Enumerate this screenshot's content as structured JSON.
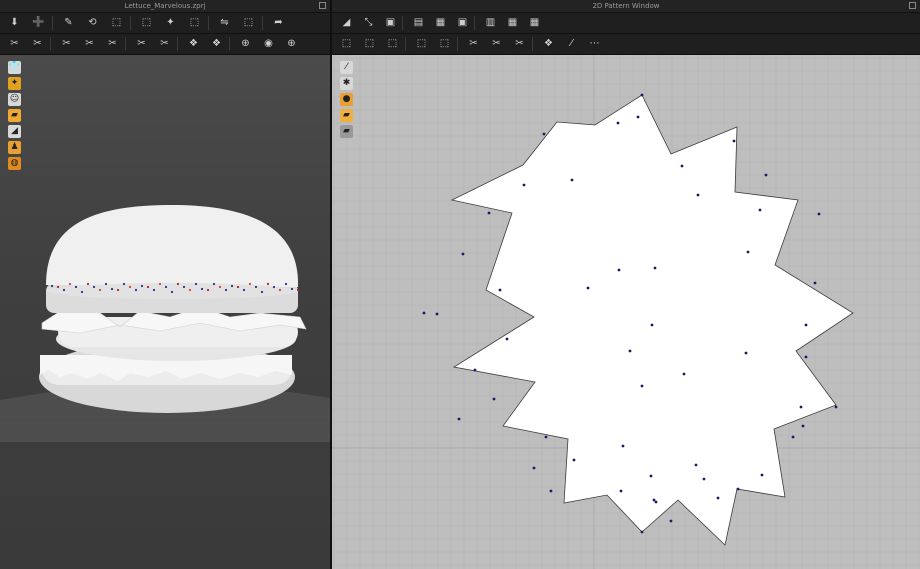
{
  "left_panel": {
    "title": "Lettuce_Marvelous.zprj"
  },
  "right_panel": {
    "title": "2D Pattern Window"
  },
  "toolbar_left_row1": [
    "⬇",
    "➕",
    "✎",
    "⟲",
    "⬚",
    "⬚",
    "✦",
    "⬚",
    "⇋",
    "⬚",
    "➦"
  ],
  "toolbar_left_row2": [
    "✂",
    "✂",
    "✂",
    "✂",
    "✂",
    "✂",
    "✂",
    "❖",
    "❖",
    "⊕",
    "◉",
    "⊕"
  ],
  "toolbar_right_row1": [
    "◢",
    "⤡",
    "▣",
    "▤",
    "▦",
    "▣",
    "▥",
    "▦",
    "▦"
  ],
  "toolbar_right_row2": [
    "⬚",
    "⬚",
    "⬚",
    "⬚",
    "⬚",
    "✂",
    "✂",
    "✂",
    "❖",
    "⁄",
    "⋯"
  ],
  "side_tools_3d": [
    {
      "name": "shirt-tool-icon",
      "glyph": "👕",
      "color": "#d8d8d8"
    },
    {
      "name": "fabric-tool-icon",
      "glyph": "✦",
      "color": "#e0a020"
    },
    {
      "name": "avatar-tool-icon",
      "glyph": "☺",
      "color": "#d8d8d8"
    },
    {
      "name": "folder-tool-icon",
      "glyph": "▰",
      "color": "#f0a830"
    },
    {
      "name": "layer-tool-icon",
      "glyph": "◢",
      "color": "#d8d8d8"
    },
    {
      "name": "person-tool-icon",
      "glyph": "♟",
      "color": "#e9a030"
    },
    {
      "name": "globe-tool-icon",
      "glyph": "◍",
      "color": "#e08a20"
    }
  ],
  "side_tools_2d": [
    {
      "name": "brush-tool-icon",
      "glyph": "⁄",
      "color": "#d8d8d8"
    },
    {
      "name": "thread-tool-icon",
      "glyph": "✱",
      "color": "#d8d8d8"
    },
    {
      "name": "stamp-tool-icon",
      "glyph": "●",
      "color": "#e9a030"
    },
    {
      "name": "pattern-folder-icon",
      "glyph": "▰",
      "color": "#f0b040"
    },
    {
      "name": "pattern-grey-icon",
      "glyph": "▰",
      "color": "#999999"
    }
  ],
  "colors": {
    "pattern_fill": "#ffffff",
    "pattern_outline": "#3b3b3b",
    "point_color": "#1a1a6a",
    "burger_color": "#f2f2f2",
    "grid_2d_minor": "#b3b3b3",
    "grid_2d_major": "#a8a8a8"
  }
}
